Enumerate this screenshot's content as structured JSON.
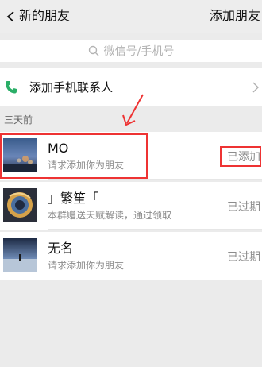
{
  "header": {
    "title": "新的朋友",
    "add_friend_label": "添加朋友"
  },
  "search": {
    "placeholder": "微信号/手机号"
  },
  "phone_contacts": {
    "label": "添加手机联系人"
  },
  "section": {
    "label": "三天前"
  },
  "friends": [
    {
      "name": "MO",
      "message": "请求添加你为朋友",
      "status": "已添加"
    },
    {
      "name": "」繁笙「",
      "message": "本群赠送天赋解读，通过领取",
      "status": "已过期"
    },
    {
      "name": "无名",
      "message": "请求添加你为朋友",
      "status": "已过期"
    }
  ],
  "colors": {
    "annotation": "#ee3333",
    "phone_icon": "#2aae67"
  }
}
